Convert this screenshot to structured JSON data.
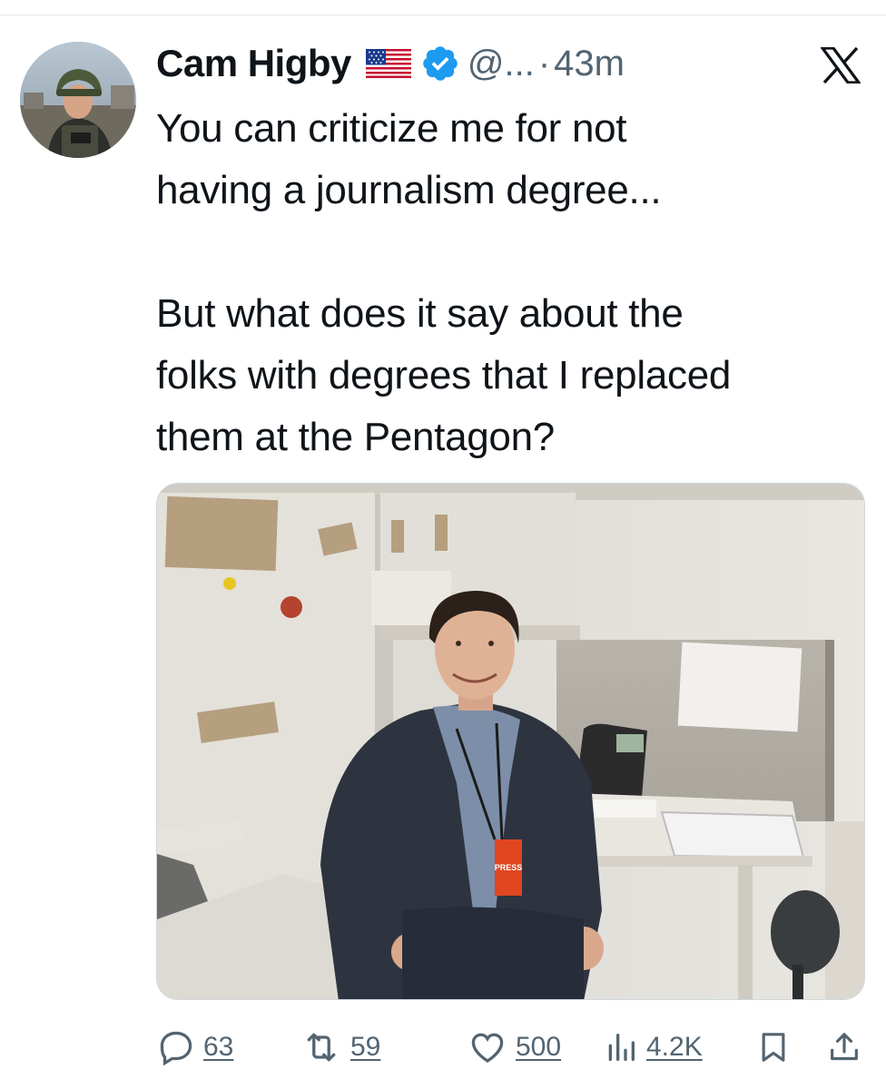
{
  "tweet": {
    "author": {
      "display_name": "Cam Higby",
      "flag_icon": "us-flag-emoji",
      "verified_icon": "blue-verified-badge",
      "handle": "@...",
      "separator": "·",
      "timestamp": "43m"
    },
    "platform_icon": "x-logo-icon",
    "text": {
      "line1": "You can criticize me for not",
      "line2": "having a journalism degree...",
      "line3": "But what does it say about the",
      "line4": "folks with degrees that I replaced",
      "line5": "them at the Pentagon?"
    },
    "media": {
      "type": "photo",
      "press_badge": "PRESS"
    },
    "actions": {
      "replies": {
        "icon": "reply-bubble-icon",
        "count": "63"
      },
      "reposts": {
        "icon": "repost-icon",
        "count": "59"
      },
      "likes": {
        "icon": "heart-icon",
        "count": "500"
      },
      "views": {
        "icon": "views-chart-icon",
        "count": "4.2K"
      },
      "bookmark": {
        "icon": "bookmark-icon"
      },
      "share": {
        "icon": "share-icon"
      }
    }
  },
  "colors": {
    "text_primary": "#0f1419",
    "text_secondary": "#536471",
    "verified_blue": "#1d9bf0",
    "divider": "#e6e9ec"
  }
}
